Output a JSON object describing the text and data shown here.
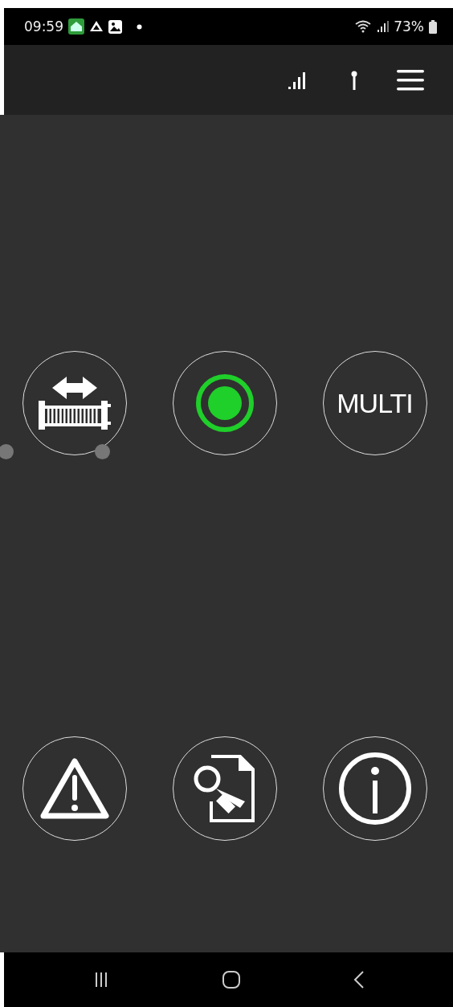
{
  "status_bar": {
    "time": "09:59",
    "battery": "73%"
  },
  "buttons": [
    {
      "kind": "gate"
    },
    {
      "kind": "status"
    },
    {
      "kind": "multi",
      "label": "MULTI"
    },
    {
      "kind": "warning"
    },
    {
      "kind": "report"
    },
    {
      "kind": "info"
    }
  ]
}
